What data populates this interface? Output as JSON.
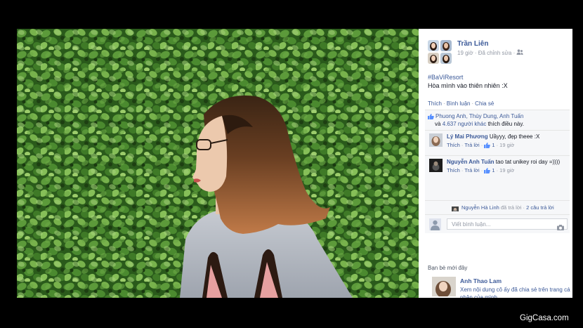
{
  "post": {
    "author": "Trần Liên",
    "time": "19 giờ",
    "edited": "Đã chỉnh sửa",
    "separator": "·",
    "hashtag": "#BaViResort",
    "caption": "Hòa mình vào thiên nhiên :X"
  },
  "actions": {
    "like": "Thích",
    "comment": "Bình luận",
    "share": "Chia sẻ",
    "separator": "·"
  },
  "likes": {
    "names": "Phuong Anh, Thùy Dung, Anh Tuấn",
    "prefix": "và",
    "others": "4.637 người khác",
    "suffix": "thích điều này."
  },
  "comments": [
    {
      "author": "Lý Mai Phương",
      "text": "Uầyyy, đẹp theee :X",
      "like": "Thích",
      "reply": "Trả lời",
      "likes": "1",
      "time": "19 giờ"
    },
    {
      "author": "Nguyễn Anh Tuấn",
      "text": "tao tat unikey roi day =))))",
      "like": "Thích",
      "reply": "Trả lời",
      "likes": "1",
      "time": "19 giờ"
    }
  ],
  "reply_summary": {
    "author": "Nguyễn Hà Linh",
    "action": "đã trả lời",
    "count": "2 câu trả lời"
  },
  "write_comment": {
    "placeholder": "Viết bình luận..."
  },
  "friends": {
    "heading": "Bạn bè mới đây",
    "name": "Anh Thao Lam",
    "text": "Xem nội dung cô ấy đã chia sẻ trên trang cá nhân của mình"
  },
  "watermark": "GigCasa.com",
  "colors": {
    "link": "#3b5998",
    "meta": "#9197a3",
    "panel": "#f6f7f9",
    "background": "#000000"
  },
  "icons": {
    "audience": "friends-icon",
    "like": "thumbs-up-icon",
    "camera": "camera-icon"
  }
}
